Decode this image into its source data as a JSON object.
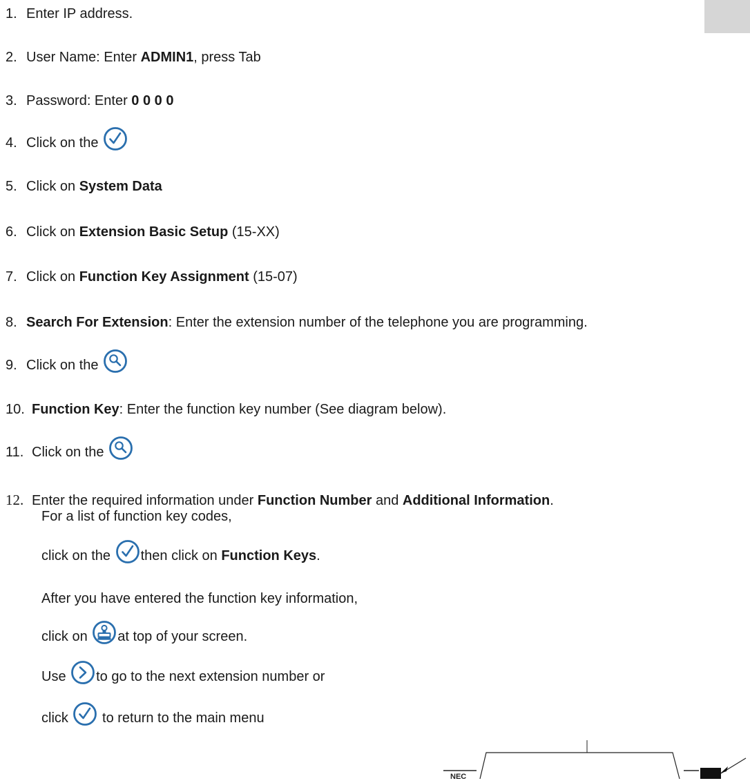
{
  "steps": [
    {
      "num": "1.",
      "text": "Enter IP address."
    },
    {
      "num": "2.",
      "pre": "User Name: Enter ",
      "bold": "ADMIN1",
      "post": ", press Tab"
    },
    {
      "num": "3.",
      "pre": "Password: Enter ",
      "bold": "0 0 0 0"
    },
    {
      "num": "4.",
      "pre": "Click on the ",
      "icon": "checkmark-circle-icon"
    },
    {
      "num": "5.",
      "pre": "Click on ",
      "bold": "System Data"
    },
    {
      "num": "6.",
      "pre": "Click on ",
      "bold": "Extension Basic Setup",
      "post": " (15-XX)"
    },
    {
      "num": "7.",
      "pre": "Click on ",
      "bold": "Function Key Assignment",
      "post": " (15-07)"
    },
    {
      "num": "8.",
      "bold": "Search For Extension",
      "post": ": Enter the extension number of the telephone you are programming."
    },
    {
      "num": "9.",
      "pre": "Click on the ",
      "icon": "magnifier-circle-icon"
    },
    {
      "num": "10.",
      "bold": "Function Key",
      "post": ": Enter the function key number (See diagram below)."
    },
    {
      "num": "11.",
      "pre": "Click on the ",
      "icon": "magnifier-circle-icon"
    },
    {
      "num": "12.",
      "pre": "Enter the required information under ",
      "bold": "Function Number",
      "mid": " and ",
      "bold2": "Additional Information",
      "post": "."
    }
  ],
  "step12_details": {
    "line1": "For a list of function key codes,",
    "line2_pre": "click on the ",
    "line2_post": "then click on ",
    "line2_bold": "Function Keys",
    "line2_end": ".",
    "line3": "After you have entered the function key information,",
    "line4_pre": "click on ",
    "line4_post": "at top of your screen.",
    "line5_pre": "Use ",
    "line5_post": "to go to the next extension number or",
    "line6_pre": "click ",
    "line6_post": " to return to the main menu"
  },
  "icons": {
    "check": "checkmark-circle-icon",
    "search": "magnifier-circle-icon",
    "save": "save-stamp-icon",
    "next": "next-arrow-circle-icon"
  },
  "colors": {
    "icon_blue": "#2a6fae",
    "text": "#1a1a1a",
    "gray_box": "#d6d6d6"
  }
}
